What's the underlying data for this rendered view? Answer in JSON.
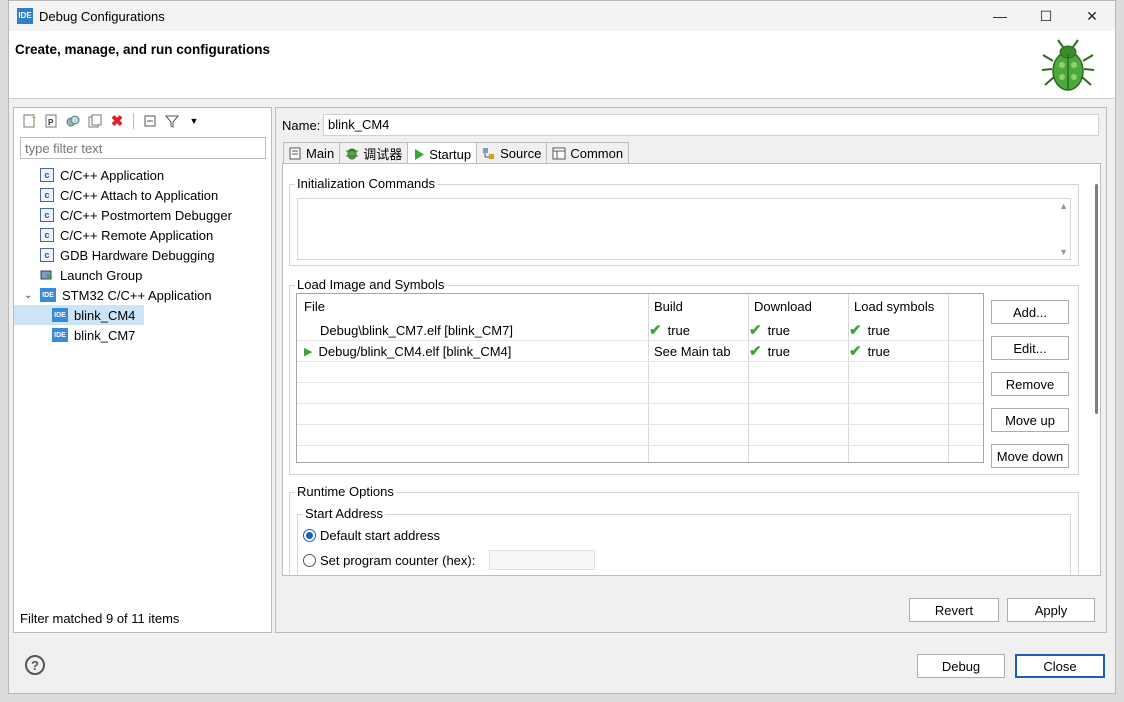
{
  "window": {
    "title": "Debug Configurations",
    "app_icon_text": "IDE",
    "controls": {
      "minimize": "—",
      "maximize": "☐",
      "close": "✕"
    }
  },
  "header": {
    "title": "Create, manage, and run configurations"
  },
  "left_pane": {
    "toolbar": [
      "new-config-icon",
      "new-prototype-icon",
      "duplicate-icon",
      "export-icon",
      "delete-icon",
      "collapse-all-icon",
      "filter-icon",
      "view-menu-icon"
    ],
    "filter_placeholder": "type filter text",
    "tree": [
      {
        "label": "C/C++ Application",
        "icon": "c-config-icon",
        "level": 0
      },
      {
        "label": "C/C++ Attach to Application",
        "icon": "c-config-icon",
        "level": 0
      },
      {
        "label": "C/C++ Postmortem Debugger",
        "icon": "c-config-icon",
        "level": 0
      },
      {
        "label": "C/C++ Remote Application",
        "icon": "c-config-icon",
        "level": 0
      },
      {
        "label": "GDB Hardware Debugging",
        "icon": "c-config-icon",
        "level": 0
      },
      {
        "label": "Launch Group",
        "icon": "launch-group-icon",
        "level": 0
      },
      {
        "label": "STM32 C/C++ Application",
        "icon": "ide-icon",
        "level": 0,
        "expanded": true
      },
      {
        "label": "blink_CM4",
        "icon": "ide-icon",
        "level": 1,
        "selected": true
      },
      {
        "label": "blink_CM7",
        "icon": "ide-icon",
        "level": 1
      }
    ],
    "status": "Filter matched 9 of 11 items"
  },
  "right_pane": {
    "name_label": "Name:",
    "name_value": "blink_CM4",
    "tabs": [
      {
        "label": "Main",
        "icon": "main-tab-icon"
      },
      {
        "label": "调试器",
        "icon": "debugger-tab-icon"
      },
      {
        "label": "Startup",
        "icon": "startup-tab-icon",
        "active": true
      },
      {
        "label": "Source",
        "icon": "source-tab-icon"
      },
      {
        "label": "Common",
        "icon": "common-tab-icon"
      }
    ],
    "init_commands": {
      "title": "Initialization Commands",
      "value": ""
    },
    "load_image": {
      "title": "Load Image and Symbols",
      "columns": [
        "File",
        "Build",
        "Download",
        "Load symbols"
      ],
      "rows": [
        {
          "file": "Debug\\blink_CM7.elf [blink_CM7]",
          "build": "true",
          "download": "true",
          "symbols": "true",
          "build_check": true,
          "running": false
        },
        {
          "file": "Debug/blink_CM4.elf [blink_CM4]",
          "build": "See Main tab",
          "download": "true",
          "symbols": "true",
          "build_check": false,
          "running": true
        }
      ],
      "buttons": [
        "Add...",
        "Edit...",
        "Remove",
        "Move up",
        "Move down"
      ]
    },
    "runtime_options": {
      "title": "Runtime Options",
      "start_address": {
        "title": "Start Address",
        "options": [
          {
            "label": "Default start address",
            "selected": true
          },
          {
            "label": "Set program counter (hex):",
            "selected": false
          }
        ],
        "pc_value": ""
      }
    },
    "revert_label": "Revert",
    "apply_label": "Apply"
  },
  "footer": {
    "help_label": "?",
    "debug_label": "Debug",
    "close_label": "Close"
  },
  "colors": {
    "accent": "#1a5fb4",
    "selection": "#cce4f7",
    "check": "#3aa53a"
  }
}
